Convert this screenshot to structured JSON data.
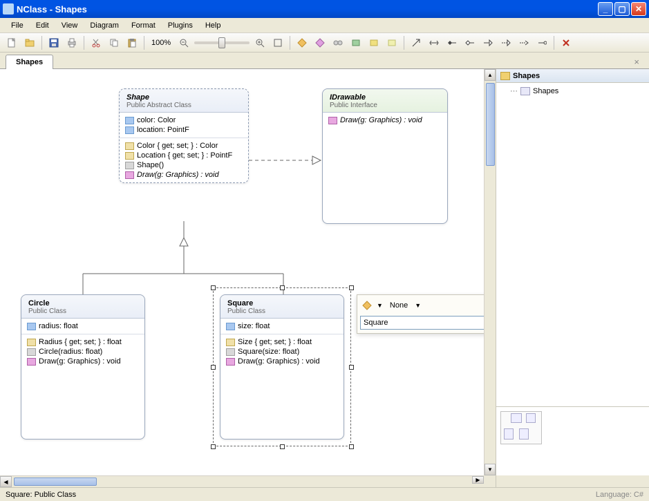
{
  "window": {
    "title": "NClass - Shapes"
  },
  "menu": {
    "file": "File",
    "edit": "Edit",
    "view": "View",
    "diagram": "Diagram",
    "format": "Format",
    "plugins": "Plugins",
    "help": "Help"
  },
  "toolbar": {
    "zoom": "100%"
  },
  "tabs": {
    "active": "Shapes"
  },
  "tree": {
    "root": "Shapes",
    "child": "Shapes"
  },
  "status": {
    "left": "Square: Public Class",
    "right": "Language: C#"
  },
  "popup": {
    "access": "None",
    "name_value": "Square"
  },
  "classes": {
    "shape": {
      "name": "Shape",
      "stereo": "Public Abstract Class",
      "fields": [
        "color: Color",
        "location: PointF"
      ],
      "props_methods": [
        {
          "icon": "prop",
          "text": "Color { get; set; } : Color"
        },
        {
          "icon": "prop",
          "text": "Location { get; set; } : PointF"
        },
        {
          "icon": "ctor",
          "text": "Shape()"
        },
        {
          "icon": "method",
          "text": "Draw(g: Graphics) : void",
          "italic": true
        }
      ]
    },
    "idrawable": {
      "name": "IDrawable",
      "stereo": "Public Interface",
      "members": [
        {
          "icon": "method",
          "text": "Draw(g: Graphics) : void",
          "italic": true
        }
      ]
    },
    "circle": {
      "name": "Circle",
      "stereo": "Public Class",
      "fields": [
        "radius: float"
      ],
      "members": [
        {
          "icon": "prop",
          "text": "Radius { get; set; } : float"
        },
        {
          "icon": "ctor",
          "text": "Circle(radius: float)"
        },
        {
          "icon": "method",
          "text": "Draw(g: Graphics) : void"
        }
      ]
    },
    "square": {
      "name": "Square",
      "stereo": "Public Class",
      "fields": [
        "size: float"
      ],
      "members": [
        {
          "icon": "prop",
          "text": "Size { get; set; } : float"
        },
        {
          "icon": "ctor",
          "text": "Square(size: float)"
        },
        {
          "icon": "method",
          "text": "Draw(g: Graphics) : void"
        }
      ]
    }
  }
}
